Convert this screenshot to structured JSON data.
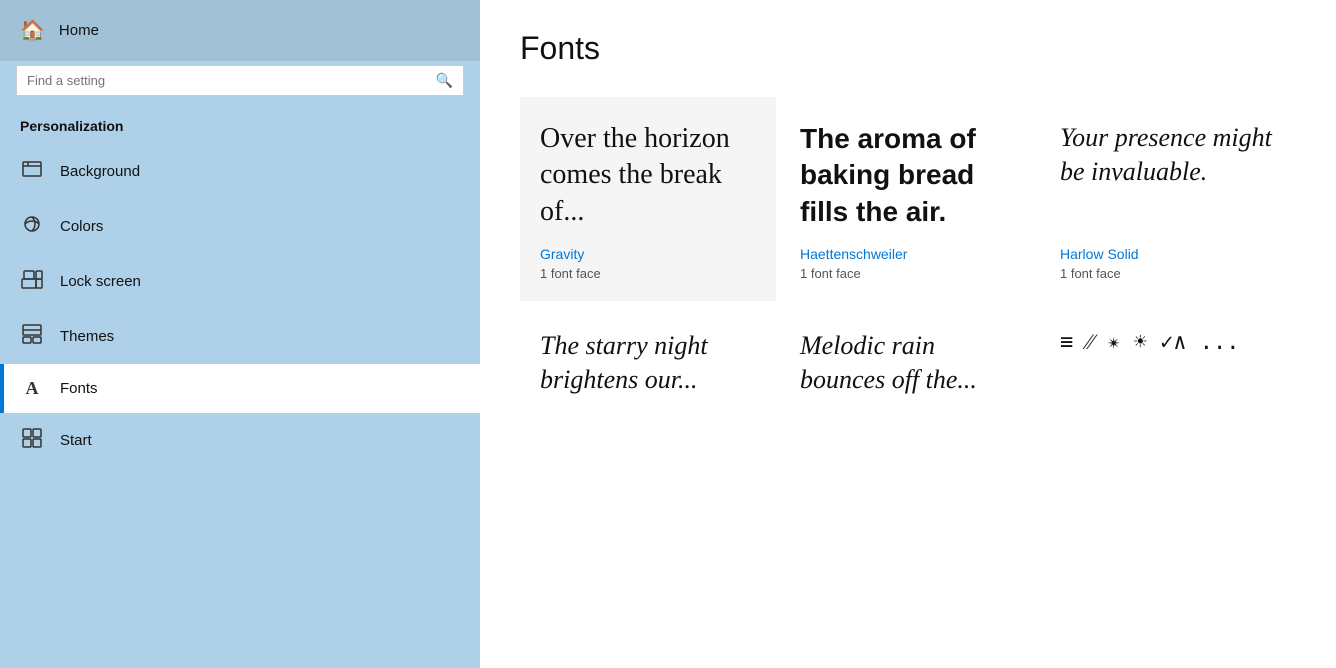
{
  "sidebar": {
    "home_label": "Home",
    "search_placeholder": "Find a setting",
    "section_title": "Personalization",
    "nav_items": [
      {
        "id": "background",
        "label": "Background",
        "icon": "🖼"
      },
      {
        "id": "colors",
        "label": "Colors",
        "icon": "🎨"
      },
      {
        "id": "lock-screen",
        "label": "Lock screen",
        "icon": "🖥"
      },
      {
        "id": "themes",
        "label": "Themes",
        "icon": "✏"
      },
      {
        "id": "fonts",
        "label": "Fonts",
        "icon": "A",
        "active": true
      },
      {
        "id": "start",
        "label": "Start",
        "icon": "⊞"
      }
    ]
  },
  "main": {
    "page_title": "Fonts",
    "font_cards": [
      {
        "id": "gravity",
        "preview": "Over the horizon comes the break of...",
        "name": "Gravity",
        "faces": "1 font face",
        "style": "gravity",
        "bg": "light"
      },
      {
        "id": "haettenschweiler",
        "preview": "The aroma of baking bread fills the air.",
        "name": "Haettenschweiler",
        "faces": "1 font face",
        "style": "haettenschweiler",
        "bg": "white"
      },
      {
        "id": "harlow-solid",
        "preview": "Your presence might be invaluable.",
        "name": "Harlow Solid",
        "faces": "1 font face",
        "style": "harlow",
        "bg": "white"
      },
      {
        "id": "starry-night",
        "preview": "The starry night brightens our...",
        "name": "",
        "faces": "",
        "style": "starry",
        "bg": "white"
      },
      {
        "id": "melodic-rain",
        "preview": "Melodic rain bounces off the...",
        "name": "",
        "faces": "",
        "style": "melodic",
        "bg": "white"
      },
      {
        "id": "symbols",
        "preview": "≡⁄⁄ ✴ ☀ ✓∧ ...",
        "name": "",
        "faces": "",
        "style": "symbols",
        "bg": "white"
      }
    ]
  }
}
